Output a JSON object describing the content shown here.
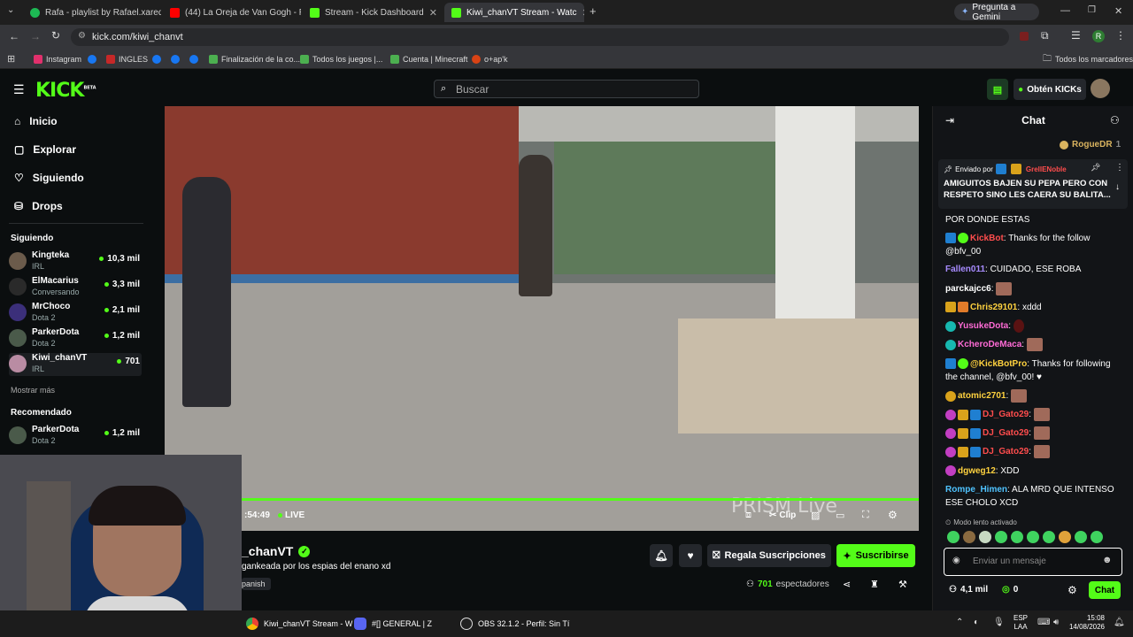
{
  "browser": {
    "tabs": [
      {
        "title": "Rafa - playlist by Rafael.xared |",
        "color": "#1db954"
      },
      {
        "title": "(44) La Oreja de Van Gogh - Ro",
        "color": "#ff0000"
      },
      {
        "title": "Stream - Kick Dashboard",
        "color": "#53fc18"
      },
      {
        "title": "Kiwi_chanVT Stream - Watc",
        "color": "#53fc18"
      }
    ],
    "gemini_label": "Pregunta a Gemini",
    "url": "kick.com/kiwi_chanvt",
    "profile_initial": "R",
    "bookmarks": [
      "Instagram",
      "INGLES",
      "Finalización de la co...",
      "Todos los juegos |...",
      "Cuenta | Minecraft",
      "o+ap'k"
    ],
    "all_bookmarks": "Todos los marcadores"
  },
  "kick": {
    "logo": "KICK",
    "logo_tag": "BETA",
    "search_placeholder": "Buscar",
    "get_kicks": "Obtén KICKs",
    "nav": [
      {
        "label": "Inicio",
        "icon": "home-icon"
      },
      {
        "label": "Explorar",
        "icon": "compass-icon"
      },
      {
        "label": "Siguiendo",
        "icon": "heart-icon"
      },
      {
        "label": "Drops",
        "icon": "gift-icon"
      }
    ],
    "following_title": "Siguiendo",
    "following": [
      {
        "name": "Kingteka",
        "game": "IRL",
        "viewers": "10,3 mil"
      },
      {
        "name": "ElMacarius",
        "game": "Conversando",
        "viewers": "3,3 mil"
      },
      {
        "name": "MrChoco",
        "game": "Dota 2",
        "viewers": "2,1 mil"
      },
      {
        "name": "ParkerDota",
        "game": "Dota 2",
        "viewers": "1,2 mil"
      },
      {
        "name": "Kiwi_chanVT",
        "game": "IRL",
        "viewers": "701"
      }
    ],
    "show_more": "Mostrar más",
    "recommended_title": "Recomendado",
    "recommended": [
      {
        "name": "ParkerDota",
        "game": "Dota 2",
        "viewers": "1,2 mil"
      }
    ]
  },
  "player": {
    "time": ":54:49",
    "live": "LIVE",
    "watermark": "PRISM Live",
    "clip": "Clip"
  },
  "stream": {
    "channel": "_chanVT",
    "title": "gankeada por los espias del enano xd",
    "language": "panish",
    "gift_subs": "Regala Suscripciones",
    "subscribe": "Suscribirse",
    "viewers": "701",
    "viewers_label": "espectadores"
  },
  "chat": {
    "title": "Chat",
    "top_gifter": "RogueDR",
    "top_gifter_count": "1",
    "pinned_label": "Enviado por",
    "pinned_user": "GrellENoble",
    "pinned_text": "AMIGUITOS BAJEN SU PEPA PERO CON RESPETO SINO LES CAERA SU BALITA...",
    "partial_line": "POR DONDE ESTAS",
    "messages": [
      {
        "user": "KickBot",
        "color": "#ff4d4d",
        "text": "Thanks for the follow @bfv_00"
      },
      {
        "user": "Fallen011",
        "color": "#a78bff",
        "text": "CUIDADO, ESE ROBA"
      },
      {
        "user": "parckajcc6",
        "color": "#ffffff",
        "text": ""
      },
      {
        "user": "Chris29101",
        "color": "#ffd23f",
        "text": "xddd"
      },
      {
        "user": "YusukeDota",
        "color": "#ff6bd6",
        "text": ""
      },
      {
        "user": "KcheroDeMaca",
        "color": "#ff6bd6",
        "text": ""
      },
      {
        "user": "@KickBotPro",
        "color": "#ffd23f",
        "text": "Thanks for following the channel, @bfv_00! ♥"
      },
      {
        "user": "atomic2701",
        "color": "#ffd23f",
        "text": ""
      },
      {
        "user": "DJ_Gato29",
        "color": "#ff4d4d",
        "text": ""
      },
      {
        "user": "DJ_Gato29",
        "color": "#ff4d4d",
        "text": ""
      },
      {
        "user": "DJ_Gato29",
        "color": "#ff4d4d",
        "text": ""
      },
      {
        "user": "dgweg12",
        "color": "#ffd23f",
        "text": "XDD"
      },
      {
        "user": "Rompe_Himen",
        "color": "#4fc3ff",
        "text": "ALA MRD QUE INTENSO ESE CHOLO XCD"
      }
    ],
    "slow_mode": "Modo lento activado",
    "input_placeholder": "Enviar un mensaje",
    "stat_followers": "4,1 mil",
    "stat_kicks": "0",
    "send": "Chat"
  },
  "taskbar": {
    "items": [
      "Kiwi_chanVT Stream - W",
      "#[] GENERAL | Z",
      "OBS 32.1.2 - Perfil: Sin Tí"
    ],
    "lang": "ESP",
    "layout": "LAA",
    "time": "15:08",
    "date": "14/08/2026"
  }
}
